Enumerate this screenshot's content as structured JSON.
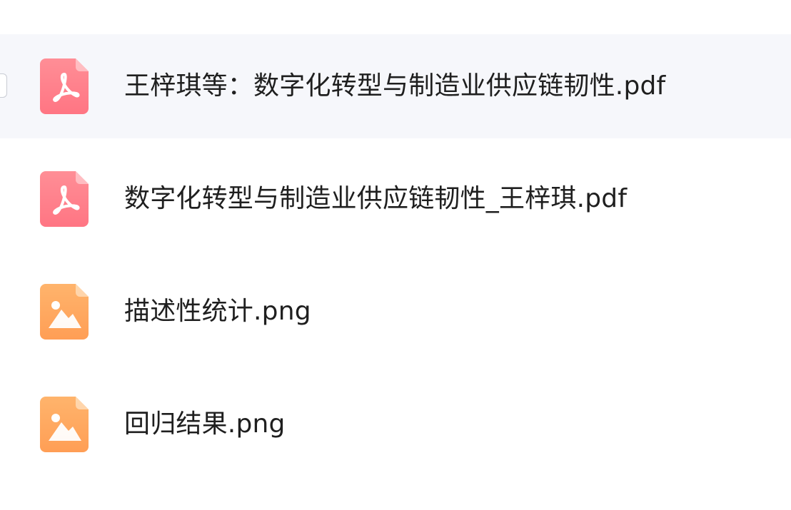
{
  "files": [
    {
      "name": "王梓琪等：数字化转型与制造业供应链韧性.pdf",
      "type": "pdf",
      "icon": "pdf-file-icon",
      "selected": true
    },
    {
      "name": "数字化转型与制造业供应链韧性_王梓琪.pdf",
      "type": "pdf",
      "icon": "pdf-file-icon",
      "selected": false
    },
    {
      "name": "描述性统计.png",
      "type": "image",
      "icon": "image-file-icon",
      "selected": false
    },
    {
      "name": "回归结果.png",
      "type": "image",
      "icon": "image-file-icon",
      "selected": false
    }
  ],
  "colors": {
    "pdf_icon_top": "#ff8e96",
    "pdf_icon_bottom": "#ff7a87",
    "image_icon_top": "#ffb36a",
    "image_icon_bottom": "#ff9f55",
    "selected_row_bg": "#f6f7fb",
    "text": "#1f1f1f"
  }
}
